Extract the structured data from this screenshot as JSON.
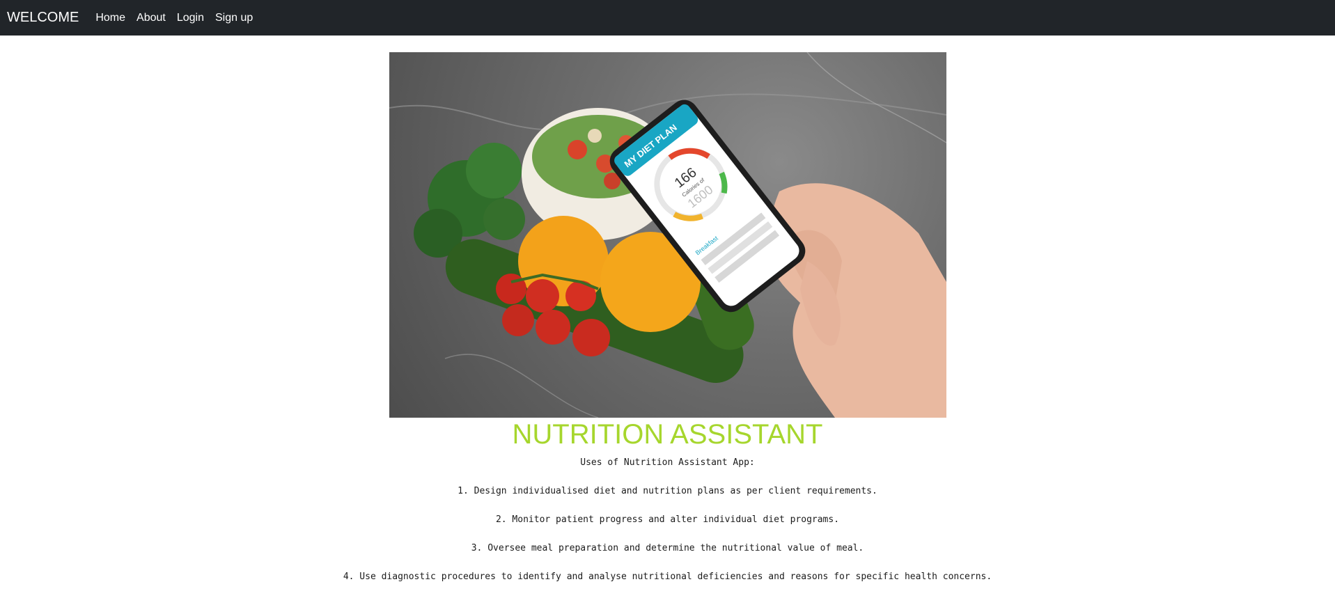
{
  "nav": {
    "brand": "WELCOME",
    "links": [
      "Home",
      "About",
      "Login",
      "Sign up"
    ]
  },
  "hero": {
    "app_header": "MY DIET PLAN",
    "calories_current": "166",
    "calories_label": "Calories of",
    "calories_goal": "1600",
    "meal_label": "Breakfast"
  },
  "content": {
    "title": "NUTRITION ASSISTANT",
    "subtitle": "Uses of Nutrition Assistant App:",
    "items": [
      "1. Design individualised diet and nutrition plans as per client requirements.",
      "2. Monitor patient progress and alter individual diet programs.",
      "3. Oversee meal preparation and determine the nutritional value of meal.",
      "4. Use diagnostic procedures to identify and analyse nutritional deficiencies and reasons for specific health concerns."
    ]
  },
  "colors": {
    "navbar": "#212529",
    "title": "#a6d62d"
  }
}
